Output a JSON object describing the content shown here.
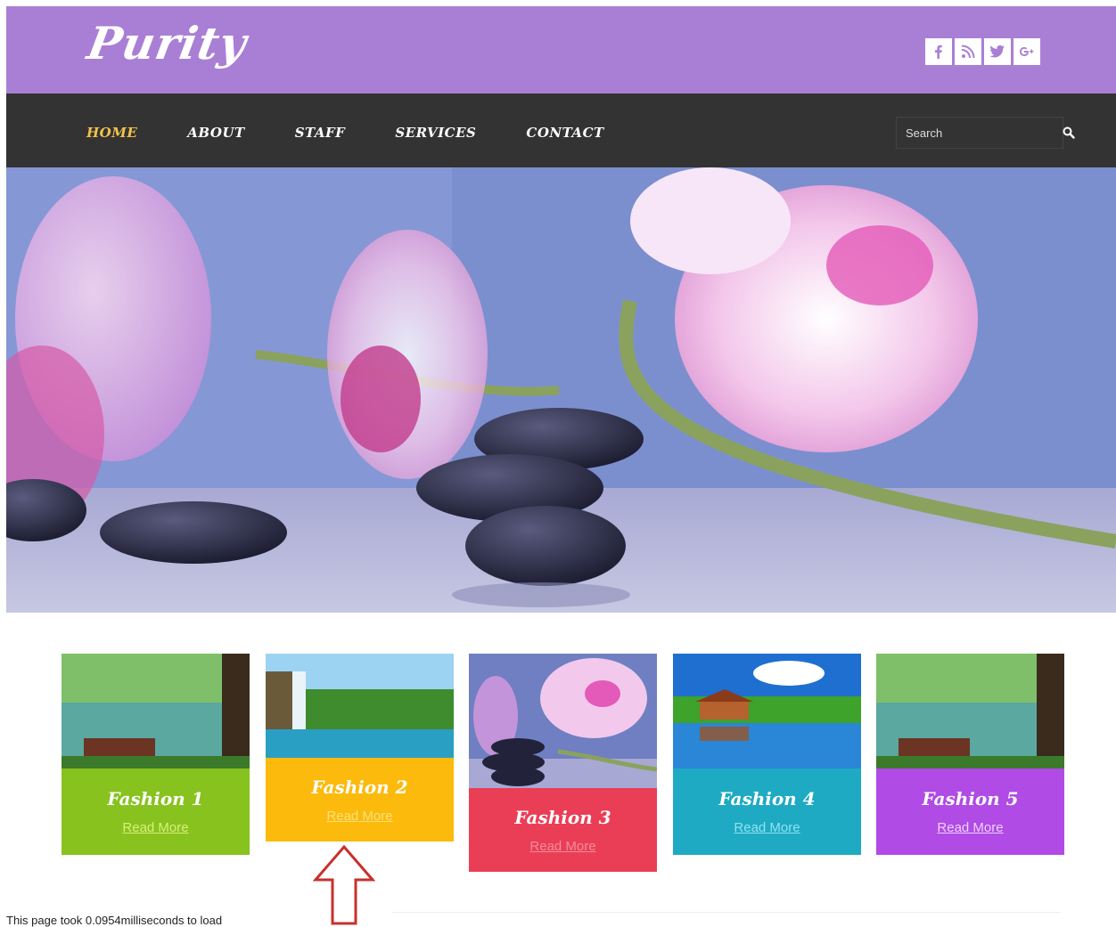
{
  "site": {
    "logo": "Purity"
  },
  "social": [
    {
      "icon": "facebook-icon",
      "glyph": "f"
    },
    {
      "icon": "rss-icon",
      "glyph": "rss"
    },
    {
      "icon": "twitter-icon",
      "glyph": "tw"
    },
    {
      "icon": "google-plus-icon",
      "glyph": "g+"
    }
  ],
  "nav": {
    "items": [
      {
        "label": "HOME",
        "active": true
      },
      {
        "label": "ABOUT",
        "active": false
      },
      {
        "label": "STAFF",
        "active": false
      },
      {
        "label": "SERVICES",
        "active": false
      },
      {
        "label": "CONTACT",
        "active": false
      }
    ],
    "active_color": "#f3c24d"
  },
  "search": {
    "placeholder": "Search",
    "icon": "search-icon"
  },
  "colors": {
    "header": "#a97fd6",
    "nav": "#333333"
  },
  "cards": [
    {
      "title": "Fashion 1",
      "link": "Read More",
      "color": "#88c21f",
      "link_color": "#d8f07a"
    },
    {
      "title": "Fashion 2",
      "link": "Read More",
      "color": "#fbba0c",
      "link_color": "#fde27a"
    },
    {
      "title": "Fashion 3",
      "link": "Read More",
      "color": "#ea3e56",
      "link_color": "#f58b9a"
    },
    {
      "title": "Fashion 4",
      "link": "Read More",
      "color": "#1eaac3",
      "link_color": "#8fe3f0"
    },
    {
      "title": "Fashion 5",
      "link": "Read More",
      "color": "#b04be5",
      "link_color": "#eed1fb"
    }
  ],
  "status": {
    "text": "This page took 0.0954milliseconds to load"
  }
}
